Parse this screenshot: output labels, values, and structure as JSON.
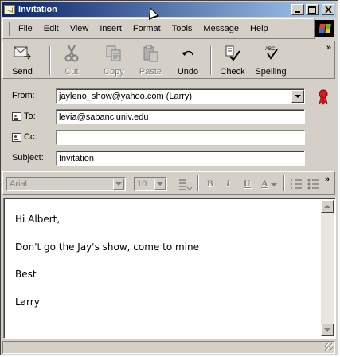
{
  "window": {
    "title": "Invitation"
  },
  "menu": [
    "File",
    "Edit",
    "View",
    "Insert",
    "Format",
    "Tools",
    "Message",
    "Help"
  ],
  "toolbar": {
    "send": "Send",
    "cut": "Cut",
    "copy": "Copy",
    "paste": "Paste",
    "undo": "Undo",
    "check": "Check",
    "spelling": "Spelling",
    "more": "»"
  },
  "header": {
    "from_label": "From:",
    "from_value": "jayleno_show@yahoo.com    (Larry)",
    "to_label": "To:",
    "to_value": "levia@sabanciuniv.edu",
    "cc_label": "Cc:",
    "cc_value": "",
    "subject_label": "Subject:",
    "subject_value": "Invitation"
  },
  "format": {
    "font": "Arial",
    "size": "10",
    "more": "»"
  },
  "message": {
    "lines": [
      "Hi Albert,",
      "Don't go the Jay's show, come to mine",
      "Best",
      "Larry"
    ]
  },
  "colors": {
    "titlebar_start": "#0a246a",
    "titlebar_end": "#a6caf0",
    "face": "#d4d0c8"
  },
  "icons": [
    "app-icon",
    "send-icon",
    "cut-icon",
    "copy-icon",
    "paste-icon",
    "undo-icon",
    "check-icon",
    "spelling-icon",
    "address-book-icon",
    "ribbon-icon",
    "windows-logo"
  ]
}
